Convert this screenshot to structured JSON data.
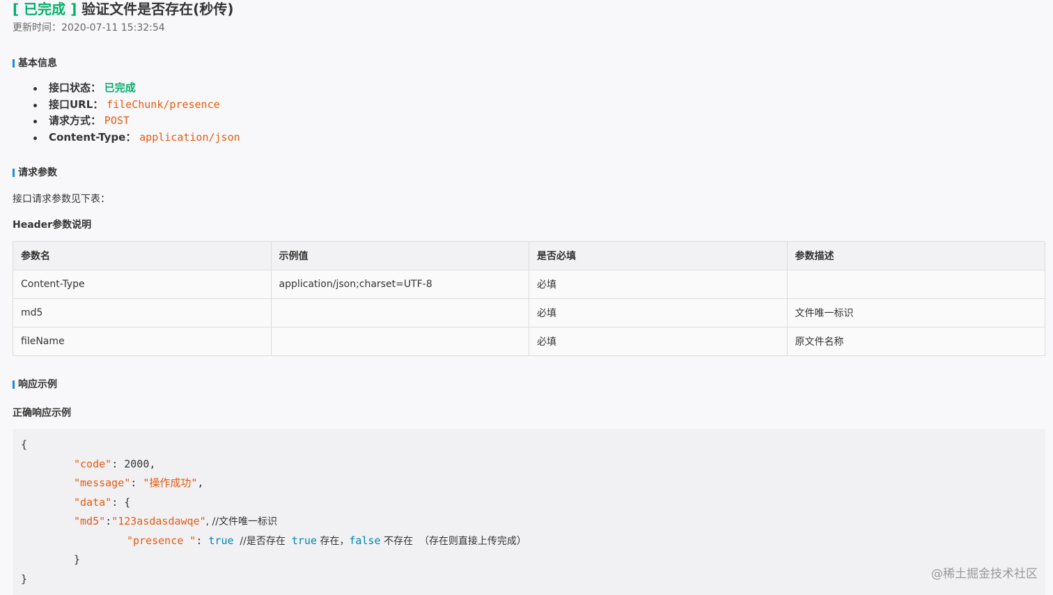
{
  "header": {
    "status_tag": "[ 已完成 ]",
    "title": "验证文件是否存在(秒传)",
    "updated": "更新时间：2020-07-11 15:32:54"
  },
  "basic_info": {
    "heading": "基本信息",
    "items": [
      {
        "label": "接口状态：",
        "value": "已完成"
      },
      {
        "label": "接口URL：",
        "value": "fileChunk/presence"
      },
      {
        "label": "请求方式：",
        "value": "POST"
      },
      {
        "label": "Content-Type：",
        "value": "application/json"
      }
    ]
  },
  "request_params": {
    "heading": "请求参数",
    "intro": "接口请求参数见下表：",
    "header_title": "Header参数说明",
    "columns": [
      "参数名",
      "示例值",
      "是否必填",
      "参数描述"
    ],
    "rows": [
      [
        "Content-Type",
        "application/json;charset=UTF-8",
        "必填",
        ""
      ],
      [
        "md5",
        "",
        "必填",
        "文件唯一标识"
      ],
      [
        "fileName",
        "",
        "必填",
        "原文件名称"
      ]
    ]
  },
  "response": {
    "heading": "响应示例",
    "sub_title": "正确响应示例",
    "code": {
      "open": "{",
      "l1_key": "\"code\"",
      "l1_rest": ": 2000,",
      "l2_key": "\"message\"",
      "l2_sep": ": ",
      "l2_val": "\"操作成功\"",
      "l2_end": ",",
      "l3_key": "\"data\"",
      "l3_rest": ": {",
      "l4_key": "\"md5\"",
      "l4_sep": ":",
      "l4_val": "\"123asdasdawqe\"",
      "l4_comment": ", //文件唯一标识",
      "l5_key": "\"presence \"",
      "l5_sep": ": ",
      "l5_true": "true",
      "l5_comment1": "  //是否存在  ",
      "l5_true2": "true",
      "l5_comment2": " 存在，",
      "l5_false": "false",
      "l5_comment3": " 不存在  （存在则直接上传完成）",
      "l6": "}",
      "close": "}"
    }
  },
  "watermark": "@稀土掘金技术社区"
}
